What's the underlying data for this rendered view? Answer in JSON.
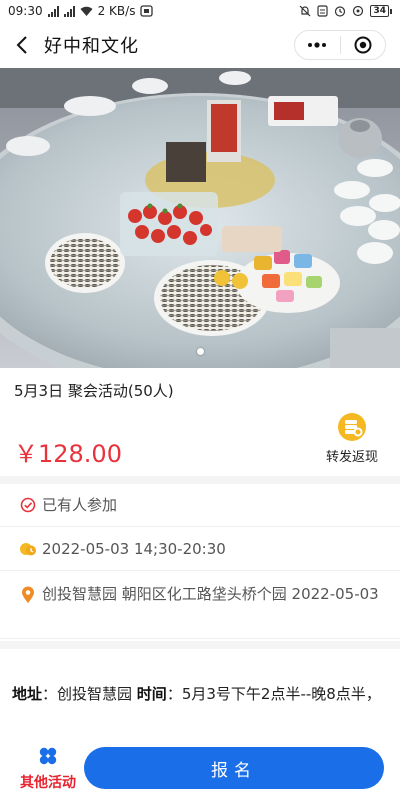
{
  "status_bar": {
    "time": "09:30",
    "network_speed": "2 KB/s",
    "battery": "34",
    "icons": [
      "signal-icon",
      "wifi-icon",
      "mute-icon",
      "alarm-icon",
      "battery-icon"
    ]
  },
  "nav": {
    "title": "好中和文化",
    "back_icon": "chevron-left-icon",
    "more_icon": "more-dots-icon",
    "close_icon": "target-close-icon"
  },
  "banner": {
    "subject": "banquet table with sunflower seeds, strawberries, candy and teacups",
    "slide_count": 1
  },
  "event": {
    "title": "5月3日 聚会活动(50人)",
    "price": "￥128.00",
    "share_label": "转发返现",
    "share_icon": "coin-stack-icon"
  },
  "info_rows": [
    {
      "icon": "check-circle-icon",
      "text": "已有人参加"
    },
    {
      "icon": "clock-coin-icon",
      "text": "2022-05-03 14;30-20:30"
    },
    {
      "icon": "location-pin-icon",
      "text": "创投智慧园 朝阳区化工路垡头桥个园 2022-05-03"
    }
  ],
  "detail": {
    "address_label": "地址",
    "address_value": "：创投智慧园 ",
    "time_label": "时间",
    "time_value": "：5月3号下午2点半--晚8点半，"
  },
  "bottom": {
    "other_label": "其他活动",
    "other_icon": "four-petal-icon",
    "signup_label": "报名"
  },
  "colors": {
    "price": "#e8323c",
    "primary_button": "#1a6fe8",
    "other_label": "#e8232f",
    "separator": "#f4f4f4"
  }
}
